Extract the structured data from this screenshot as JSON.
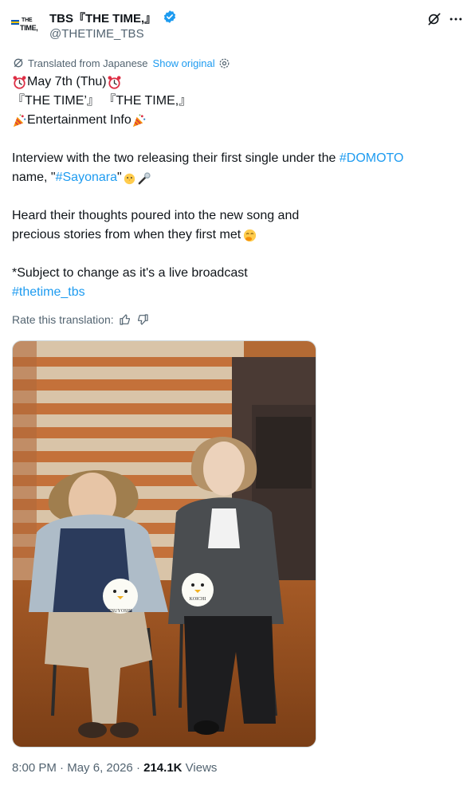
{
  "account": {
    "logo_text_top": "THE",
    "logo_text_bottom": "TIME,",
    "display_name": "TBS『THE TIME,』",
    "handle": "@THETIME_TBS"
  },
  "translation": {
    "label": "Translated from Japanese",
    "show_original": "Show original",
    "rate_label": "Rate this translation:"
  },
  "tweet": {
    "line1": "May 7th (Thu)",
    "line2": "『THE TIME’』 『THE TIME,』",
    "line3": "Entertainment Info",
    "line4_a": "Interview with the two releasing their first single under the ",
    "line4_tag": "#DOMOTO",
    "line5_a": "name, \"",
    "line5_tag": "#Sayonara",
    "line5_b": "\"",
    "line6": "Heard their thoughts poured into the new song and",
    "line7": "precious stories from when they first met",
    "line8": "*Subject to change as it's a live broadcast",
    "line9_tag": "#thetime_tbs"
  },
  "photo": {
    "plush_left_label": "TSUYOSHI",
    "plush_right_label": "KOICHI"
  },
  "meta": {
    "time": "8:00 PM",
    "sep1": " · ",
    "date": "May 6, 2026",
    "sep2": " · ",
    "views_count": "214.1K",
    "views_label": " Views"
  },
  "colors": {
    "link": "#1d9bf0",
    "secondary": "#536471",
    "verified": "#1d9bf0"
  },
  "icons": [
    "verified-badge-icon",
    "grok-icon",
    "more-icon",
    "translate-icon",
    "gear-icon",
    "thumbs-up-icon",
    "thumbs-down-icon",
    "alarm-clock-emoji",
    "party-popper-emoji",
    "chick-emoji",
    "microphone-emoji",
    "hand-over-mouth-emoji"
  ]
}
